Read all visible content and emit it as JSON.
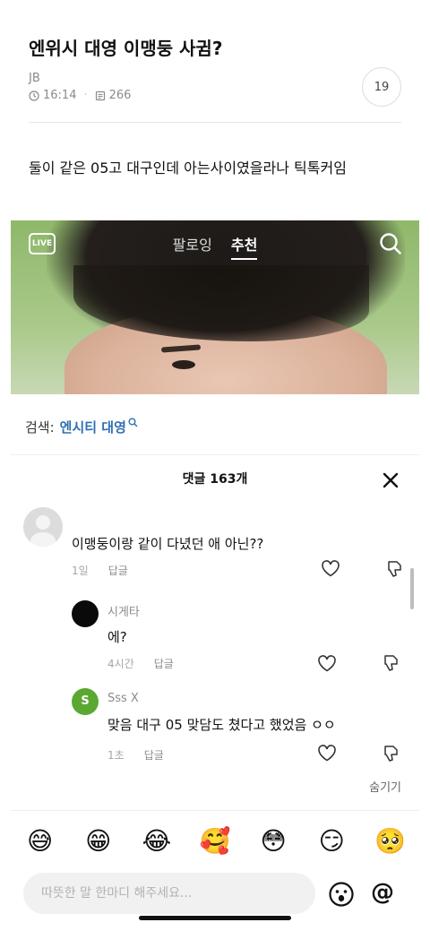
{
  "post": {
    "title": "엔위시 대영 이맹둥 사귐?",
    "author": "JB",
    "time": "16:14",
    "views": "266",
    "comment_count": "19",
    "body": "둘이 같은 05고 대구인데 아는사이였을라나 틱톡커임"
  },
  "tiktok": {
    "live_label": "LIVE",
    "tabs": [
      "팔로잉",
      "추천"
    ],
    "active_tab": "추천",
    "search_label": "검색:",
    "search_term": "엔시티 대영"
  },
  "comments_panel": {
    "header": "댓글 163개",
    "reply_label": "답글",
    "hide_label": "숨기기",
    "comments": [
      {
        "name": "",
        "text": "이맹둥이랑 같이 다녔던 애 아닌??",
        "time": "1일",
        "avatar_color": "#d8d8d8"
      },
      {
        "name": "시게타",
        "text": "에?",
        "time": "4시간",
        "avatar_color": "#0a0a0a"
      },
      {
        "name": "Sss X",
        "text": "맞음 대구 05 맞담도 쳤다고 했었음 ㅇㅇ",
        "time": "1초",
        "avatar_color": "#5aa832",
        "avatar_letter": "S"
      }
    ]
  },
  "emojis": [
    "😅",
    "😁",
    "😂",
    "🥰",
    "😳",
    "😏",
    "🥺"
  ],
  "input": {
    "placeholder": "따뜻한 말 한마디 해주세요...",
    "at_label": "@"
  }
}
